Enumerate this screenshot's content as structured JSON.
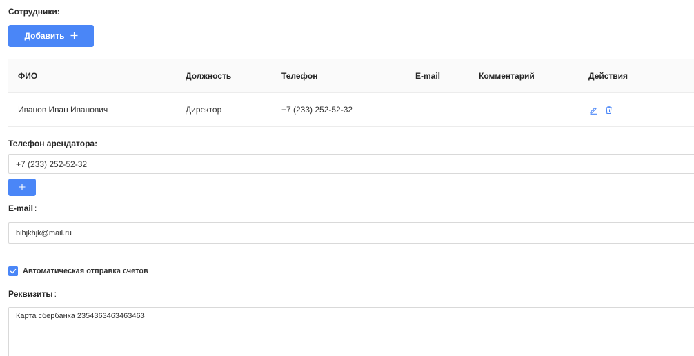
{
  "employees": {
    "label": "Сотрудники:",
    "add_button_label": "Добавить",
    "table": {
      "columns": [
        "ФИО",
        "Должность",
        "Телефон",
        "E-mail",
        "Комментарий",
        "Действия"
      ],
      "rows": [
        {
          "name": "Иванов Иван Иванович",
          "position": "Директор",
          "phone": "+7 (233) 252-52-32",
          "email": "",
          "comment": ""
        }
      ]
    }
  },
  "tenant_phone": {
    "label": "Телефон арендатора:",
    "value": "+7 (233) 252-52-32"
  },
  "email": {
    "label": "E-mail",
    "separator": ":",
    "value": "bihjkhjk@mail.ru"
  },
  "auto_invoice": {
    "label": "Автоматическая отправка счетов",
    "checked": true
  },
  "requisites": {
    "label": "Реквизиты",
    "separator": ":",
    "value": "Карта сбербанка 2354363463463463"
  },
  "colors": {
    "primary": "#4a86f7",
    "header_bg": "#fafafa",
    "border": "#d9d9d9"
  },
  "icons": {
    "add": "plus-icon",
    "edit": "pencil-icon",
    "delete": "trash-icon",
    "check": "checkmark-icon"
  }
}
